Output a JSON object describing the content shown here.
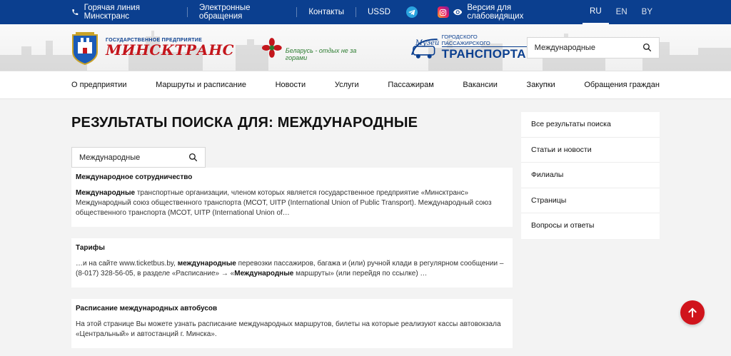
{
  "topbar": {
    "hotline": "Горячая линия Минсктранс",
    "appeals": "Электронные обращения",
    "contacts": "Контакты",
    "ussd": "USSD",
    "vision": "Версия для слабовидящих",
    "languages": [
      "RU",
      "EN",
      "BY"
    ],
    "active_language": "RU"
  },
  "header": {
    "logo_sub": "ГОСУДАРСТВЕННОЕ ПРЕДПРИЯТИЕ",
    "logo_name": "МИНСКТРАНС",
    "belarus_slogan": "Беларусь - отдых не за горами",
    "museum_script": "Музей",
    "museum_sub": "Городского пассажирского",
    "museum_name": "ТРАНСПОРТА",
    "search_value": "Международные"
  },
  "nav": [
    "О предприятии",
    "Маршруты и расписание",
    "Новости",
    "Услуги",
    "Пассажирам",
    "Вакансии",
    "Закупки",
    "Обращения граждан"
  ],
  "main": {
    "title": "РЕЗУЛЬТАТЫ ПОИСКА ДЛЯ: МЕЖДУНАРОДНЫЕ",
    "search_value": "Международные",
    "results": [
      {
        "title": "Международное сотрудничество",
        "parts": [
          {
            "b": "Международные"
          },
          {
            "t": " транспортные организации, членом которых является государственное предприятие «Минсктранс» Международный союз общественного транспорта (МСОТ, UITP (International Union of Public Transport). Международный союз общественного транспорта (МСОТ, UITP (International Union of…"
          }
        ]
      },
      {
        "title": "Тарифы",
        "parts": [
          {
            "t": "…и на сайте www.ticketbus.by, "
          },
          {
            "b": "международные"
          },
          {
            "t": " перевозки пассажиров, багажа и (или) ручной клади в регулярном сообщении – (8-017) 328-56-05, в разделе «Расписание» → «"
          },
          {
            "b": "Международные"
          },
          {
            "t": " маршруты» (или перейдя по ссылке)     …"
          }
        ]
      },
      {
        "title": "Расписание международных автобусов",
        "parts": [
          {
            "t": "На этой странице Вы можете узнать расписание международных маршрутов, билеты на которые реализуют кассы автовокзала «Центральный» и автостанций г. Минска»."
          }
        ]
      }
    ]
  },
  "sidebar": [
    "Все результаты поиска",
    "Статьи и новости",
    "Филиалы",
    "Страницы",
    "Вопросы и ответы"
  ],
  "colors": {
    "topbar": "#0b3f8f",
    "brand_red": "#c4161c",
    "up_button": "#d0141c"
  }
}
